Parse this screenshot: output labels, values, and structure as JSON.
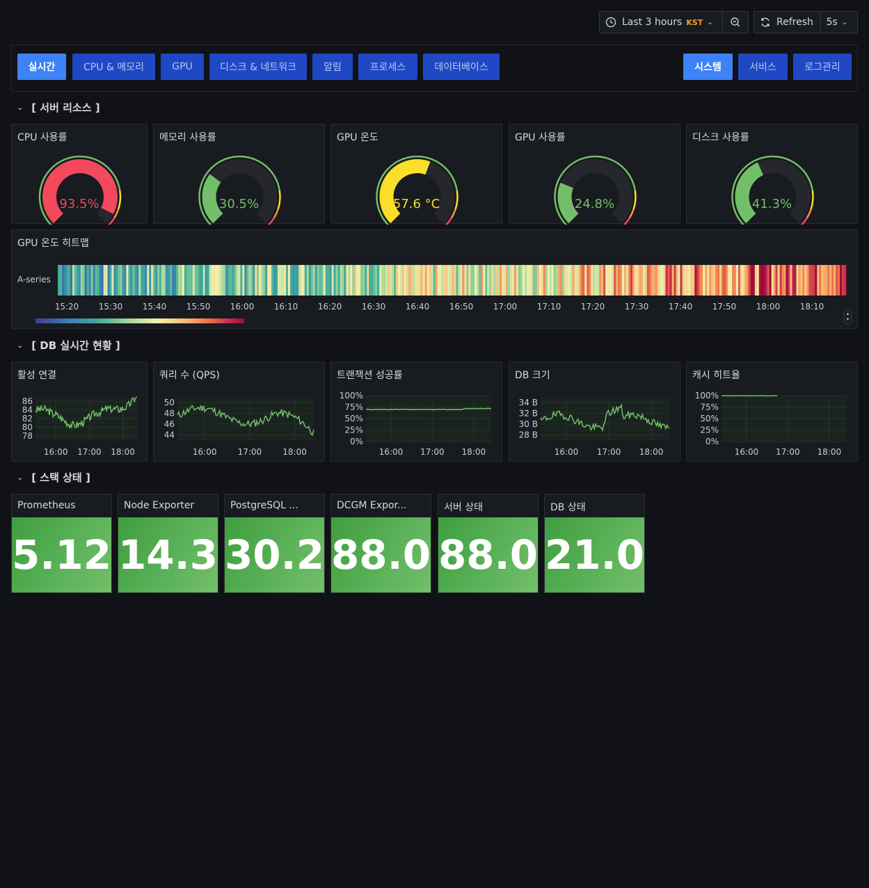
{
  "toolbar": {
    "time_range": "Last 3 hours",
    "timezone": "KST",
    "refresh_label": "Refresh",
    "refresh_interval": "5s"
  },
  "nav": {
    "left": [
      "실시간",
      "CPU & 메모리",
      "GPU",
      "디스크 & 네트워크",
      "알림",
      "프로세스",
      "데이터베이스"
    ],
    "right": [
      "시스템",
      "서비스",
      "로그관리"
    ],
    "active": [
      "실시간",
      "시스템"
    ]
  },
  "sections": {
    "server": "[ 서버 리소스 ]",
    "db": "[ DB 실시간 현황 ]",
    "stack": "[ 스택 상태 ]"
  },
  "gauges": [
    {
      "title": "CPU 사용률",
      "value": 93.5,
      "display": "93.5%",
      "color": "#f2495c"
    },
    {
      "title": "메모리 사용률",
      "value": 30.5,
      "display": "30.5%",
      "color": "#73bf69"
    },
    {
      "title": "GPU 온도",
      "value": 57.6,
      "display": "57.6 °C",
      "color": "#fade2a"
    },
    {
      "title": "GPU 사용률",
      "value": 24.8,
      "display": "24.8%",
      "color": "#73bf69"
    },
    {
      "title": "디스크 사용률",
      "value": 41.3,
      "display": "41.3%",
      "color": "#73bf69"
    }
  ],
  "heatmap": {
    "title": "GPU 온도 히트맵",
    "series_label": "A-series",
    "x_ticks": [
      "15:20",
      "15:30",
      "15:40",
      "15:50",
      "16:00",
      "16:10",
      "16:20",
      "16:30",
      "16:40",
      "16:50",
      "17:00",
      "17:10",
      "17:20",
      "17:30",
      "17:40",
      "17:50",
      "18:00",
      "18:10"
    ]
  },
  "db_panels": [
    {
      "title": "활성 연결",
      "y_ticks": [
        "86",
        "84",
        "82",
        "80",
        "78"
      ],
      "x_ticks": [
        "16:00",
        "17:00",
        "18:00"
      ]
    },
    {
      "title": "쿼리 수 (QPS)",
      "y_ticks": [
        "50",
        "48",
        "46",
        "44"
      ],
      "x_ticks": [
        "16:00",
        "17:00",
        "18:00"
      ]
    },
    {
      "title": "트랜잭션 성공률",
      "y_ticks": [
        "100%",
        "75%",
        "50%",
        "25%",
        "0%"
      ],
      "x_ticks": [
        "16:00",
        "17:00",
        "18:00"
      ]
    },
    {
      "title": "DB 크기",
      "y_ticks": [
        "34 B",
        "32 B",
        "30 B",
        "28 B"
      ],
      "x_ticks": [
        "16:00",
        "17:00",
        "18:00"
      ]
    },
    {
      "title": "캐시 히트율",
      "y_ticks": [
        "100%",
        "75%",
        "50%",
        "25%",
        "0%"
      ],
      "x_ticks": [
        "16:00",
        "17:00",
        "18:00"
      ]
    }
  ],
  "stats": [
    {
      "title": "Prometheus",
      "value": "5.12"
    },
    {
      "title": "Node Exporter",
      "value": "14.3"
    },
    {
      "title": "PostgreSQL ...",
      "value": "30.2"
    },
    {
      "title": "DCGM Expor...",
      "value": "88.0"
    },
    {
      "title": "서버 상태",
      "value": "88.0"
    },
    {
      "title": "DB 상태",
      "value": "21.0"
    }
  ],
  "colors": {
    "green": "#73bf69",
    "red": "#f2495c",
    "yellow": "#fade2a",
    "nav_blue": "#1f48c4",
    "nav_active": "#3d82f6"
  }
}
